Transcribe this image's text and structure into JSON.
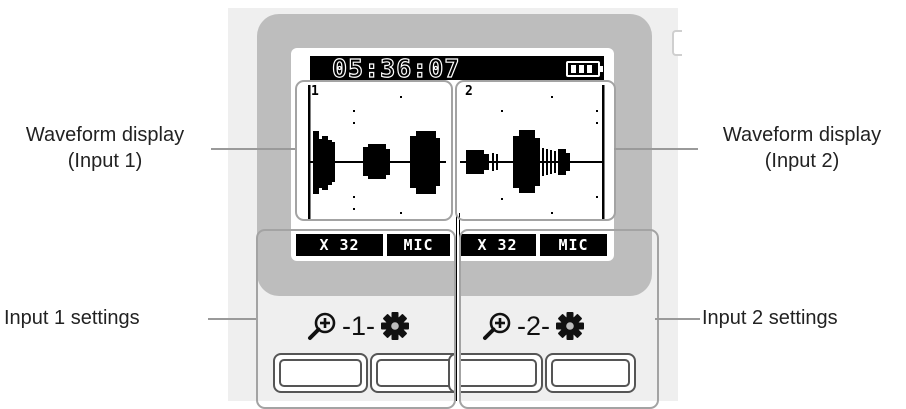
{
  "display": {
    "time": "05:36:07"
  },
  "channels": [
    {
      "number": "1",
      "gain": "X 32",
      "mode": "MIC"
    },
    {
      "number": "2",
      "gain": "X 32",
      "mode": "MIC"
    }
  ],
  "annotations": {
    "waveform_1": "Waveform display\n(Input 1)",
    "waveform_2": "Waveform display\n(Input 2)",
    "input_1": "Input 1 settings",
    "input_2": "Input 2 settings"
  },
  "controls": {
    "input_1_label": "-1-",
    "input_2_label": "-2-"
  }
}
